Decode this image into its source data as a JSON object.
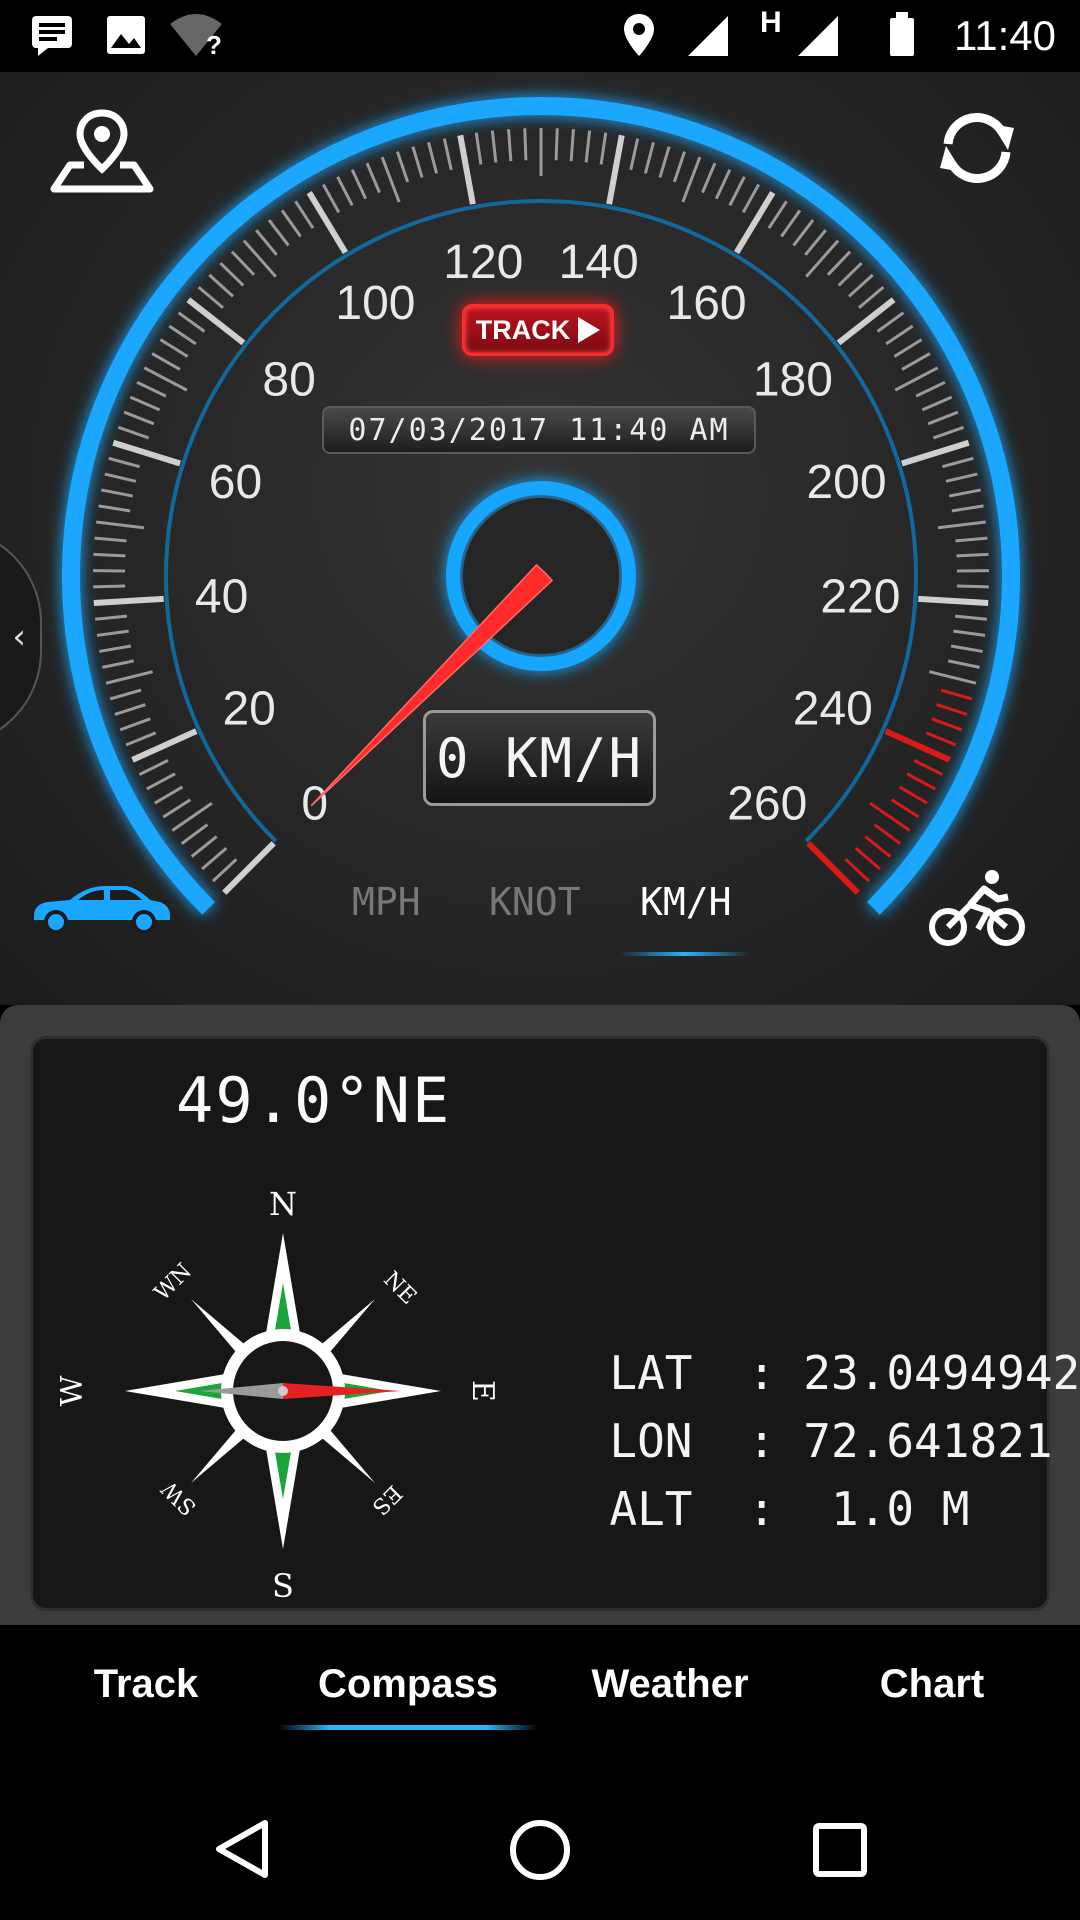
{
  "status_bar": {
    "time": "11:40",
    "icons": [
      "notification-message-icon",
      "gallery-icon",
      "wifi-unknown-icon",
      "location-pin-icon",
      "signal-icon",
      "h-network-icon",
      "battery-icon"
    ],
    "network_letter": "H",
    "wifi_mark": "?"
  },
  "speedometer": {
    "tick_labels": [
      "0",
      "20",
      "40",
      "60",
      "80",
      "100",
      "120",
      "140",
      "160",
      "180",
      "200",
      "220",
      "240",
      "260"
    ],
    "min": 0,
    "max": 260,
    "current_speed": 0,
    "speed_display": "0 KM/H",
    "datetime": "07/03/2017 11:40 AM",
    "track_button_label": "TRACK",
    "units": [
      "MPH",
      "KNOT",
      "KM/H"
    ],
    "selected_unit": "KM/H",
    "accent_color": "#1aa7ff",
    "needle_color": "#ff2a2a"
  },
  "compass": {
    "heading": "49.0°NE",
    "labels": {
      "n": "N",
      "e": "E",
      "s": "S",
      "w": "W",
      "ne": "NE",
      "es": "ES",
      "sw": "SW",
      "wn": "WN"
    },
    "gps": {
      "lat_label": "LAT",
      "lat_value": "23.0494942",
      "lon_label": "LON",
      "lon_value": "72.641821",
      "alt_label": "ALT",
      "alt_value": "1.0 M",
      "separator": ":"
    }
  },
  "tabs": [
    {
      "label": "Track"
    },
    {
      "label": "Compass"
    },
    {
      "label": "Weather"
    },
    {
      "label": "Chart"
    }
  ],
  "active_tab": "Compass"
}
